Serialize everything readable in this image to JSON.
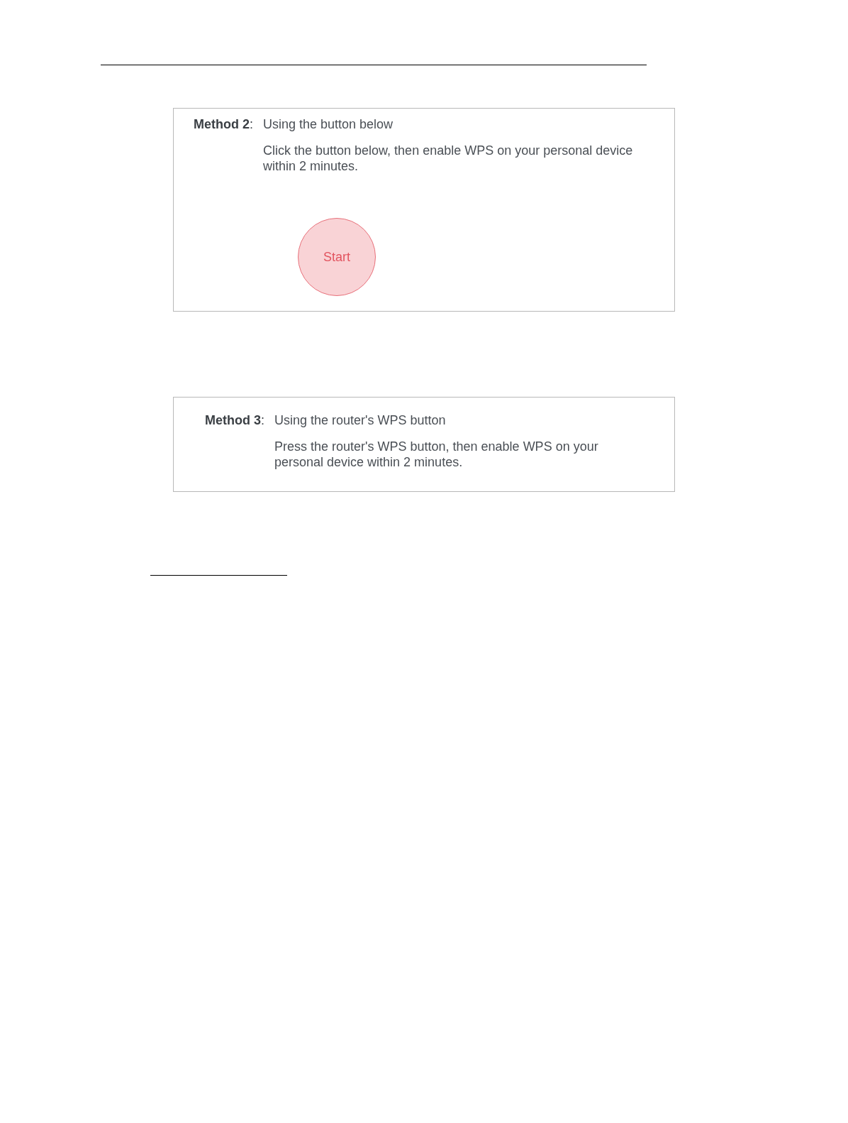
{
  "panels": [
    {
      "label": "**Method 2**:",
      "title": "Using the button below",
      "description": "Click the button below, then enable WPS on your personal device within 2 minutes.",
      "button": "Start"
    },
    {
      "label": "**Method 3**:",
      "title": "Using the router's WPS button",
      "description": "Press the router's WPS button, then enable WPS on your personal device within 2 minutes."
    }
  ]
}
